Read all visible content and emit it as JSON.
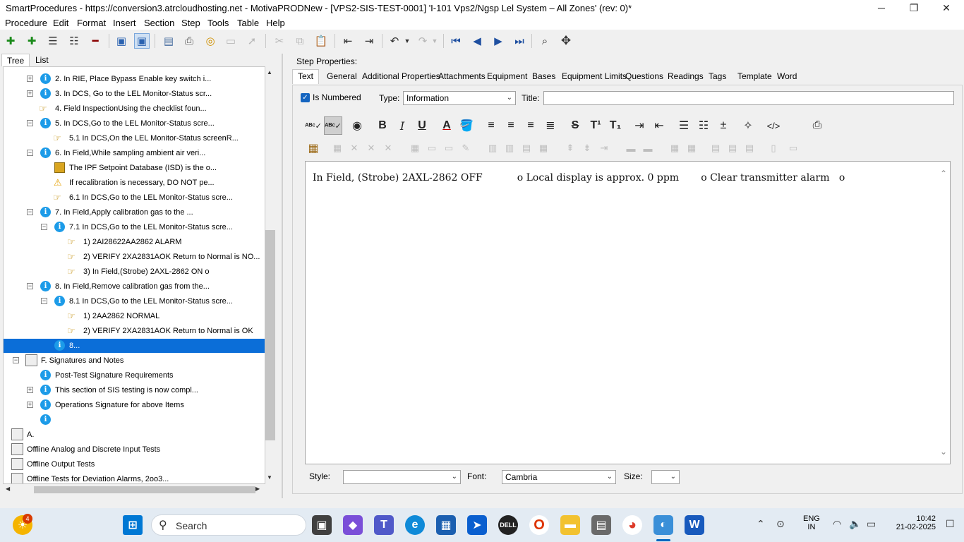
{
  "window": {
    "title": "SmartProcedures - https://conversion3.atrcloudhosting.net - MotivaPRODNew - [VPS2-SIS-TEST-0001] 'I-101 Vps2/Ngsp Lel System – All Zones' (rev: 0)*",
    "min_glyph": "─",
    "max_glyph": "❐",
    "close_glyph": "✕"
  },
  "menu": [
    "Procedure",
    "Edit",
    "Format",
    "Insert",
    "Section",
    "Step",
    "Tools",
    "Table",
    "Help"
  ],
  "left_tabs": {
    "tree": "Tree",
    "list": "List"
  },
  "tree": {
    "rows": [
      {
        "text": "2. In RIE, Place Bypass Enable key switch i...",
        "icon": "info"
      },
      {
        "text": "3. In DCS, Go to the LEL Monitor-Status scr...",
        "icon": "info"
      },
      {
        "text": "4. Field InspectionUsing the checklist foun...",
        "icon": "hand"
      },
      {
        "text": "5. In DCS,Go to the LEL Monitor-Status scre...",
        "icon": "info"
      },
      {
        "text": "5.1 In DCS,On the LEL Monitor-Status screenR...",
        "icon": "hand"
      },
      {
        "text": "6. In Field,While sampling ambient air veri...",
        "icon": "info"
      },
      {
        "text": "The IPF Setpoint Database (ISD) is the o...",
        "icon": "database"
      },
      {
        "text": "If recalibration is necessary, DO NOT pe...",
        "icon": "warning"
      },
      {
        "text": "6.1 In DCS,Go to the LEL Monitor-Status scre...",
        "icon": "hand"
      },
      {
        "text": "7. In Field,Apply calibration gas to the ...",
        "icon": "info"
      },
      {
        "text": "7.1 In DCS,Go to the LEL Monitor-Status scre...",
        "icon": "info"
      },
      {
        "text": "1) 2AI28622AA2862 ALARM",
        "icon": "hand"
      },
      {
        "text": "2) VERIFY 2XA2831AOK Return to Normal is NO...",
        "icon": "hand"
      },
      {
        "text": "3) In Field,(Strobe) 2AXL-2862 ON o",
        "icon": "hand"
      },
      {
        "text": "8. In Field,Remove calibration gas from the...",
        "icon": "info"
      },
      {
        "text": "8.1 In DCS,Go to the LEL Monitor-Status scre...",
        "icon": "info"
      },
      {
        "text": "1) 2AA2862 NORMAL",
        "icon": "hand"
      },
      {
        "text": "2) VERIFY 2XA2831AOK Return to Normal is OK",
        "icon": "hand"
      },
      {
        "text": "8...",
        "icon": "info"
      },
      {
        "text": "F. Signatures and Notes",
        "icon": "document"
      },
      {
        "text": "Post-Test Signature Requirements",
        "icon": "info"
      },
      {
        "text": "This section of SIS testing is now compl...",
        "icon": "info"
      },
      {
        "text": "Operations Signature for above Items",
        "icon": "info"
      },
      {
        "text": "",
        "icon": "info"
      },
      {
        "text": "A.",
        "icon": "document"
      },
      {
        "text": "Offline Analog and Discrete Input Tests",
        "icon": "document"
      },
      {
        "text": "Offline Output Tests",
        "icon": "document"
      },
      {
        "text": "Offline Tests for Deviation Alarms, 2oo3...",
        "icon": "document"
      }
    ]
  },
  "step_properties": {
    "header": "Step Properties:",
    "tabs": [
      "Text",
      "General",
      "Additional Properties",
      "Attachments",
      "Equipment",
      "Bases",
      "Equipment Limits",
      "Questions",
      "Readings",
      "Tags",
      "Template",
      "Word"
    ],
    "is_numbered_label": "Is Numbered",
    "type_label": "Type:",
    "type_value": "Information",
    "title_label": "Title:",
    "title_value": "",
    "editor_text": "In Field, (Strobe) 2AXL-2862 OFF           o Local display is approx. 0 ppm       o Clear transmitter alarm   o",
    "style_label": "Style:",
    "style_value": "",
    "font_label": "Font:",
    "font_value": "Cambria",
    "size_label": "Size:",
    "size_value": ""
  },
  "taskbar": {
    "notification_count": "4",
    "search_label": "Search",
    "lang": "ENG",
    "region": "IN",
    "time": "10:42",
    "date": "21-02-2025"
  },
  "colors": {
    "accent": "#0b6ed8",
    "info_icon": "#1c9be8"
  }
}
